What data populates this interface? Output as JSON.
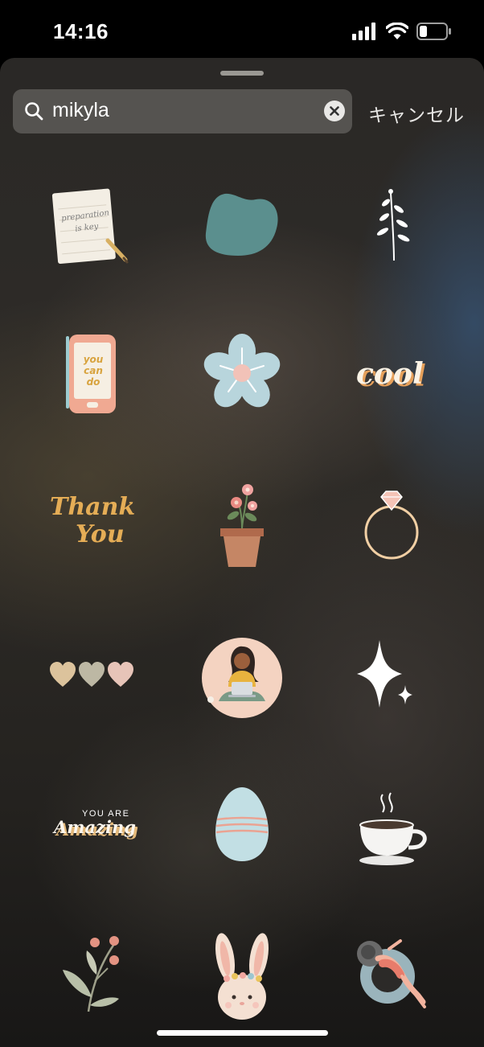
{
  "status_bar": {
    "time": "14:16"
  },
  "search": {
    "query": "mikyla",
    "cancel_label": "キャンセル"
  },
  "stickers": {
    "notepad_text": "preparation is key",
    "phone_text_1": "you",
    "phone_text_2": "can",
    "phone_text_3": "do",
    "cool_text": "cool",
    "thank_text_1": "Thank",
    "thank_text_2": "You",
    "amazing_small": "YOU ARE",
    "amazing_big": "Amazing"
  }
}
